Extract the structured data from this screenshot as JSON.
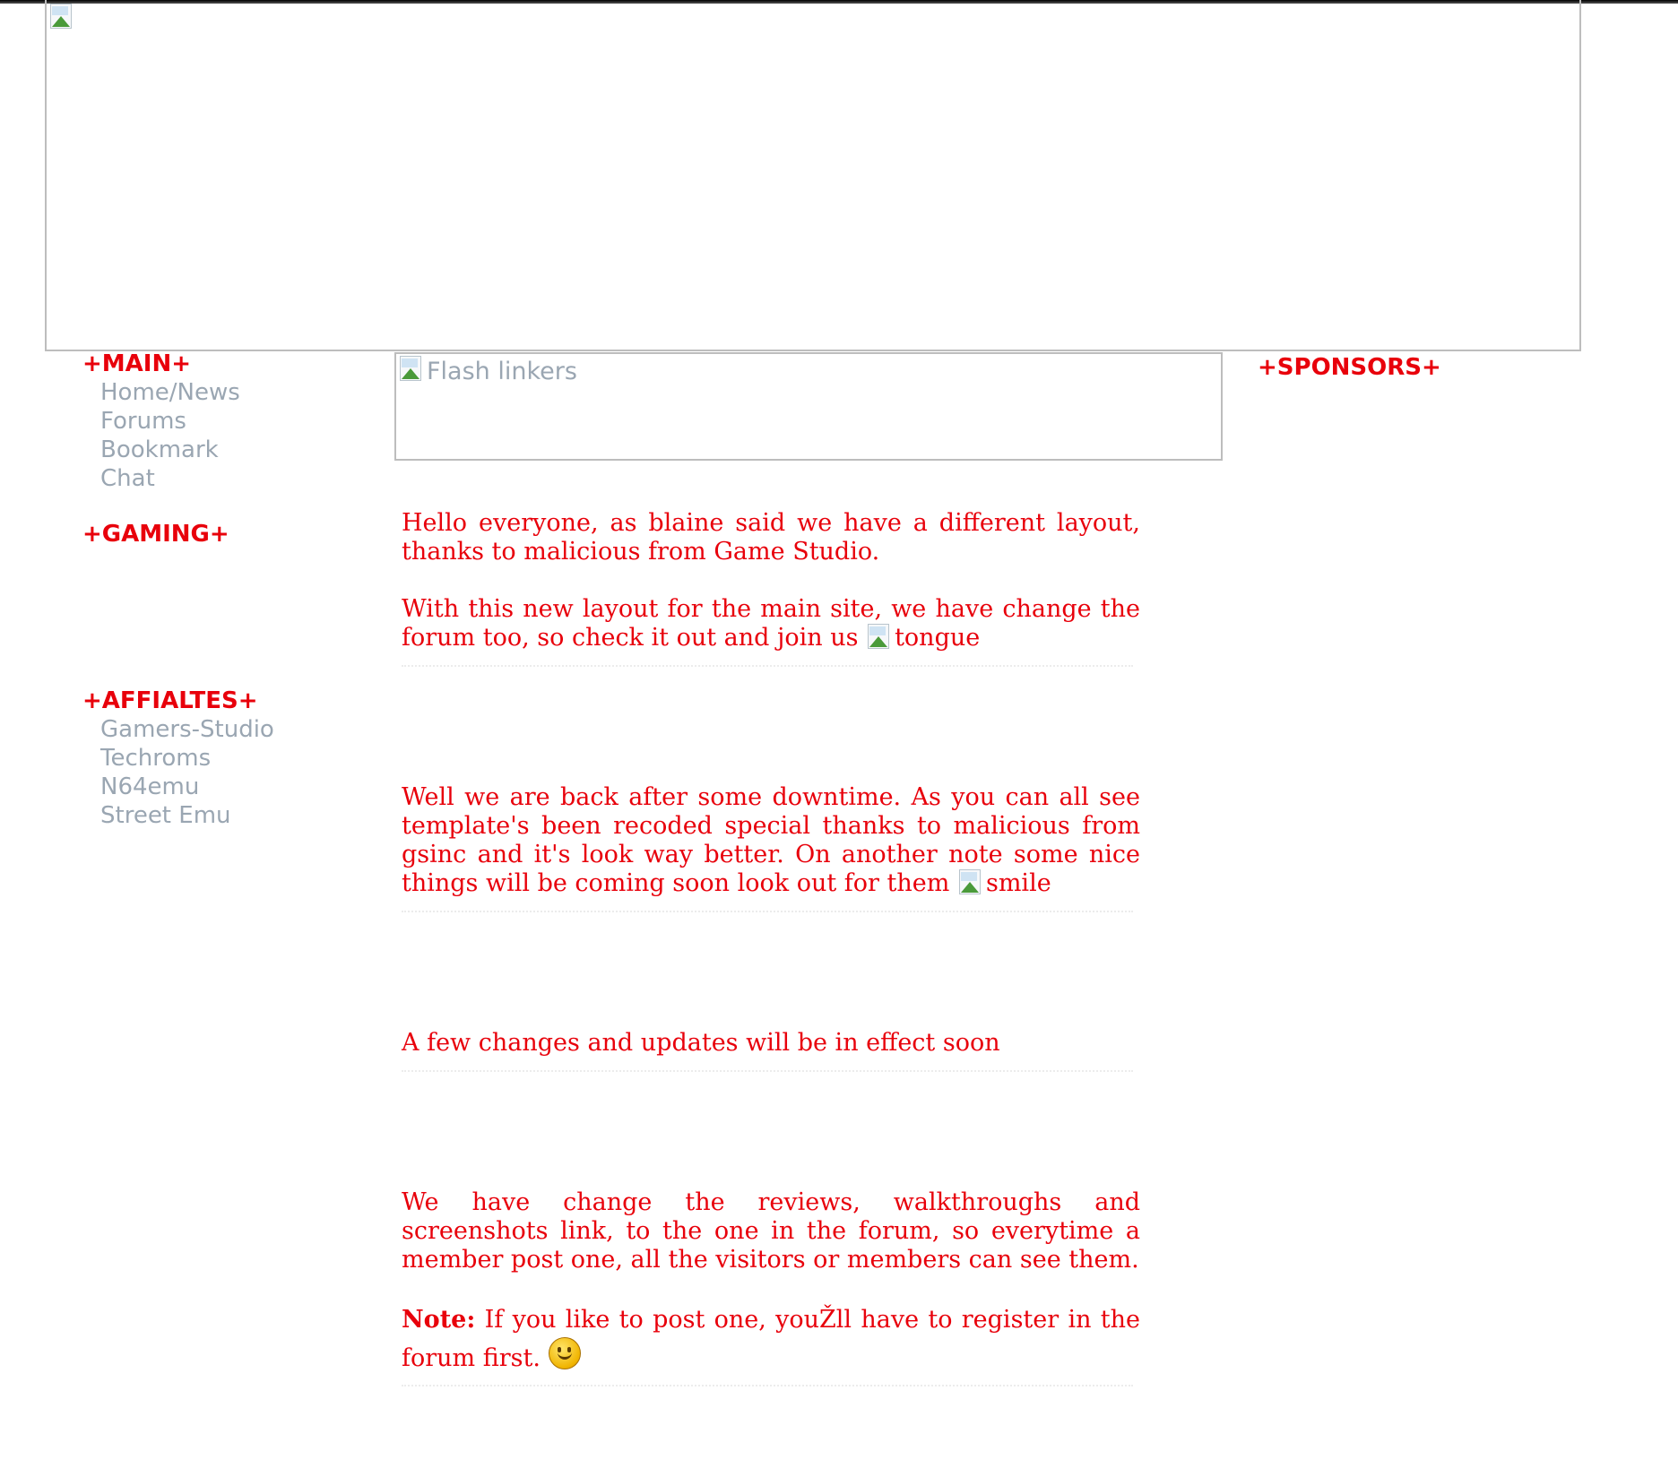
{
  "left_nav": {
    "main_heading": "+MAIN+",
    "main_items": [
      "Home/News",
      "Forums",
      "Bookmark",
      "Chat"
    ],
    "gaming_heading": "+GAMING+",
    "affiliates_heading": "+AFFIALTES+",
    "affiliate_items": [
      "Gamers-Studio",
      "Techroms",
      "N64emu",
      "Street Emu"
    ]
  },
  "flash": {
    "alt_text": "Flash linkers"
  },
  "right_nav": {
    "sponsors_heading": "+SPONSORS+"
  },
  "news": {
    "post1": {
      "para1": "Hello everyone, as blaine said we have a different layout, thanks to malicious from Game Studio.",
      "para2": "With this new layout for the main site, we have change the forum too, so check it out and join us",
      "emoticon_alt": "tongue"
    },
    "post2": {
      "text": "Well we are back after some downtime. As you can all see template's been recoded special thanks to malicious from gsinc and it's look way better. On another note some nice things will be coming soon look out for them",
      "emoticon_alt": "smile"
    },
    "post3": {
      "text": "A few changes and updates will be in effect soon"
    },
    "post4": {
      "para1": "We have change the reviews, walkthroughs and screenshots link, to the one in the forum, so everytime a member post one, all the visitors or members can see them.",
      "note_label": "Note:",
      "note_text": " If you like to post one, youŽll have to register in the forum first."
    }
  },
  "colors": {
    "accent": "#e8000b",
    "link": "#9aa6b2",
    "border": "#bdbdbd"
  }
}
